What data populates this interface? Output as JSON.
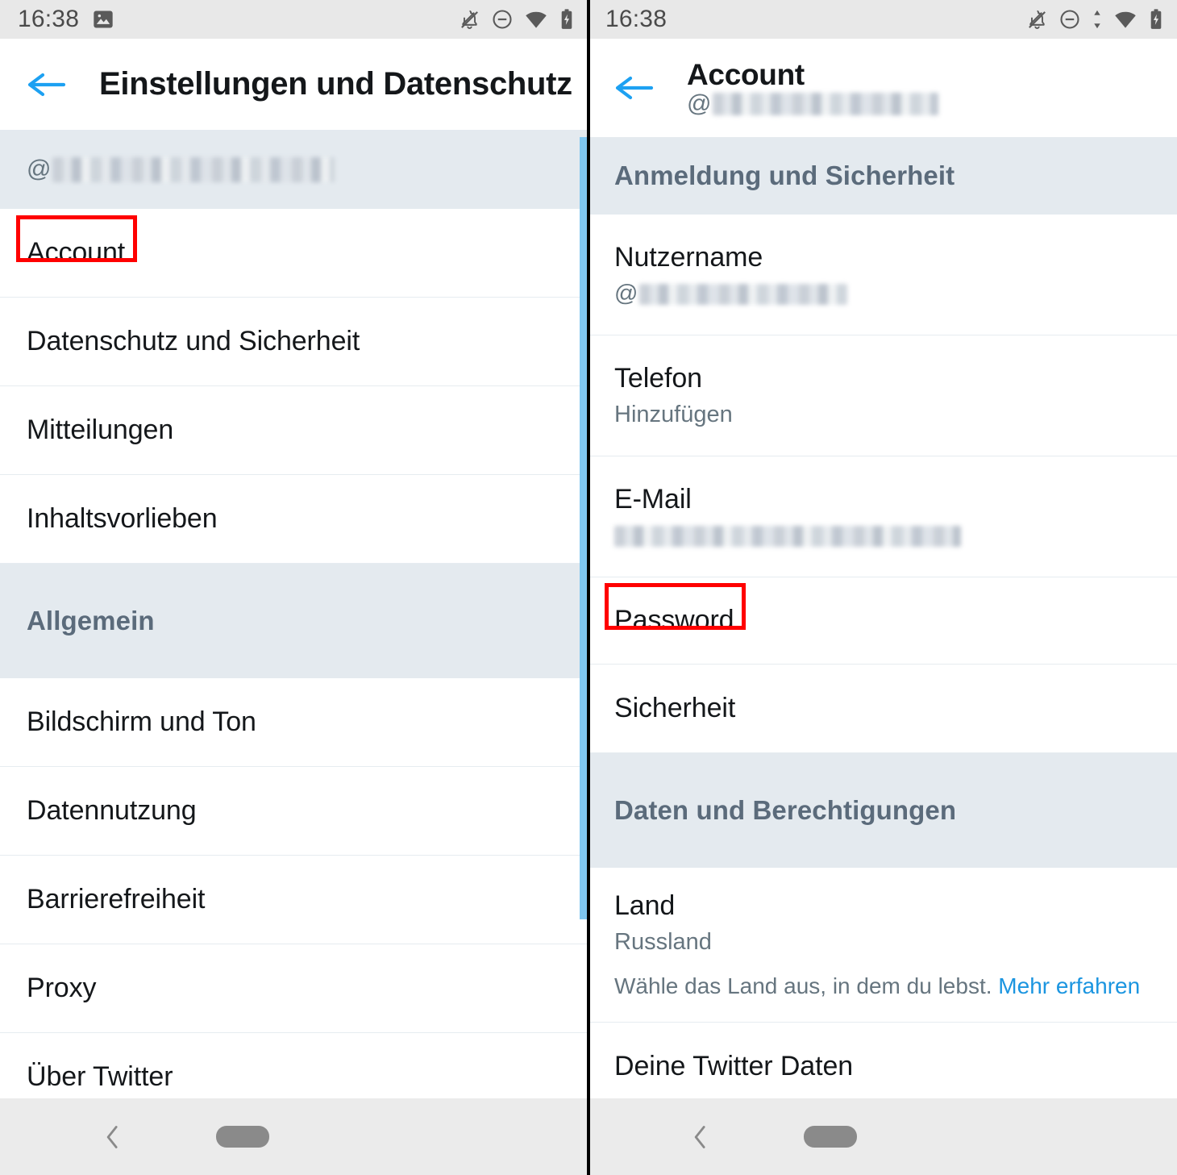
{
  "status_bar": {
    "time": "16:38",
    "left_icons": [
      "image-icon"
    ],
    "right_icons_left_screen": [
      "notifications-off-icon",
      "do-not-disturb-icon",
      "wifi-icon",
      "battery-charging-icon"
    ],
    "right_icons_right_screen": [
      "notifications-off-icon",
      "do-not-disturb-icon",
      "data-transfer-icon",
      "wifi-icon",
      "battery-charging-icon"
    ]
  },
  "left_screen": {
    "appbar": {
      "back_label": "back-arrow",
      "title": "Einstellungen und Datenschutz"
    },
    "account_handle": {
      "at": "@",
      "value_redacted": true
    },
    "items": [
      {
        "label": "Account",
        "highlighted": true
      },
      {
        "label": "Datenschutz und Sicherheit",
        "highlighted": false
      },
      {
        "label": "Mitteilungen",
        "highlighted": false
      },
      {
        "label": "Inhaltsvorlieben",
        "highlighted": false
      }
    ],
    "section_general": "Allgemein",
    "general_items": [
      {
        "label": "Bildschirm und Ton"
      },
      {
        "label": "Datennutzung"
      },
      {
        "label": "Barrierefreiheit"
      },
      {
        "label": "Proxy"
      },
      {
        "label": "Über Twitter"
      }
    ]
  },
  "right_screen": {
    "appbar": {
      "back_label": "back-arrow",
      "title": "Account",
      "subtitle_at": "@",
      "subtitle_redacted": true
    },
    "section_login": "Anmeldung und Sicherheit",
    "login_items": [
      {
        "label": "Nutzername",
        "value_at": "@",
        "value_redacted": true,
        "highlighted": false
      },
      {
        "label": "Telefon",
        "value": "Hinzufügen",
        "highlighted": false
      },
      {
        "label": "E-Mail",
        "value_redacted": true,
        "highlighted": false
      },
      {
        "label": "Password",
        "highlighted": true
      },
      {
        "label": "Sicherheit",
        "highlighted": false
      }
    ],
    "section_data": "Daten und Berechtigungen",
    "data_items": [
      {
        "label": "Land",
        "value": "Russland",
        "hint": "Wähle das Land aus, in dem du lebst.",
        "hint_link": "Mehr erfahren"
      },
      {
        "label": "Deine Twitter Daten"
      }
    ]
  },
  "colors": {
    "accent_blue": "#1DA1F2",
    "link_blue": "#1B95E0",
    "section_bg": "#E4EAEF",
    "section_text": "#5B6B7B",
    "highlight_red": "#FF0000",
    "scrollbar": "#7FC6F0",
    "statusbar_bg": "#E8E8E8",
    "navbar_bg": "#EBEBEB"
  }
}
